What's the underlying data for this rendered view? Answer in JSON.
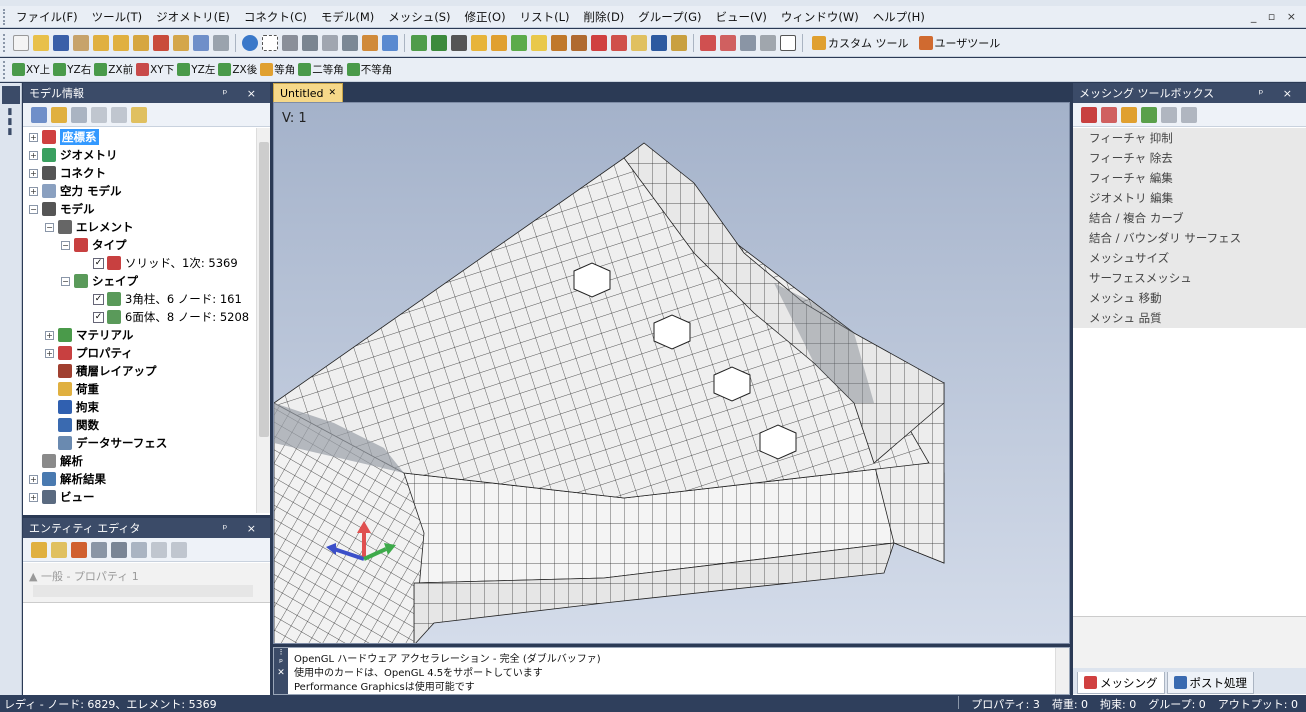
{
  "menubar": {
    "items": [
      "ファイル(F)",
      "ツール(T)",
      "ジオメトリ(E)",
      "コネクト(C)",
      "モデル(M)",
      "メッシュ(S)",
      "修正(O)",
      "リスト(L)",
      "削除(D)",
      "グループ(G)",
      "ビュー(V)",
      "ウィンドウ(W)",
      "ヘルプ(H)"
    ],
    "mdi_controls": "_ ▫ ×"
  },
  "toolbar1": {
    "custom_tool": "カスタム ツール",
    "user_tool": "ユーザツール"
  },
  "toolbar2": {
    "views": [
      "XY上",
      "YZ右",
      "ZX前",
      "XY下",
      "YZ左",
      "ZX後",
      "等角",
      "二等角",
      "不等角"
    ]
  },
  "model_panel": {
    "title": "モデル情報",
    "pin": "ᵖ ×",
    "tree": [
      {
        "label": "座標系",
        "selected": true
      },
      {
        "label": "ジオメトリ"
      },
      {
        "label": "コネクト"
      },
      {
        "label": "空力 モデル"
      },
      {
        "label": "モデル"
      },
      {
        "label": "エレメント"
      },
      {
        "label": "タイプ"
      },
      {
        "label": "ソリッド、1次: 5369"
      },
      {
        "label": "シェイプ"
      },
      {
        "label": "3角柱、6 ノード: 161"
      },
      {
        "label": "6面体、8 ノード: 5208"
      },
      {
        "label": "マテリアル"
      },
      {
        "label": "プロパティ"
      },
      {
        "label": "積層レイアップ"
      },
      {
        "label": "荷重"
      },
      {
        "label": "拘束"
      },
      {
        "label": "関数"
      },
      {
        "label": "データサーフェス"
      },
      {
        "label": "解析"
      },
      {
        "label": "解析結果"
      },
      {
        "label": "ビュー"
      }
    ]
  },
  "entity_panel": {
    "title": "エンティティ エディタ",
    "group": "▲ 一般 - プロパティ 1"
  },
  "document": {
    "tab": "Untitled",
    "view_label": "V: 1"
  },
  "output": {
    "lines": [
      "OpenGL ハードウェア アクセラレーション - 完全 (ダブルバッファ)",
      "使用中のカードは、OpenGL 4.5をサポートしています",
      "Performance Graphicsは使用可能です"
    ]
  },
  "toolbox": {
    "title": "メッシング ツールボックス",
    "items": [
      "フィーチャ 抑制",
      "フィーチャ 除去",
      "フィーチャ 編集",
      "ジオメトリ 編集",
      "結合 / 複合 カーブ",
      "結合 / バウンダリ サーフェス",
      "メッシュサイズ",
      "サーフェスメッシュ",
      "メッシュ 移動",
      "メッシュ 品質"
    ],
    "tabs": [
      "メッシング",
      "ポスト処理"
    ]
  },
  "status": {
    "left": "レディ - ノード: 6829、エレメント: 5369",
    "property": "プロパティ: 3",
    "load": "荷重: 0",
    "constraint": "拘束: 0",
    "group": "グループ: 0",
    "output": "アウトプット: 0"
  },
  "colors": {
    "panel_header": "#3b4b68",
    "accent_tab": "#f6d889",
    "selection": "#3399ff",
    "viewport_top": "#a4b2ca",
    "viewport_bottom": "#d4dcea"
  }
}
